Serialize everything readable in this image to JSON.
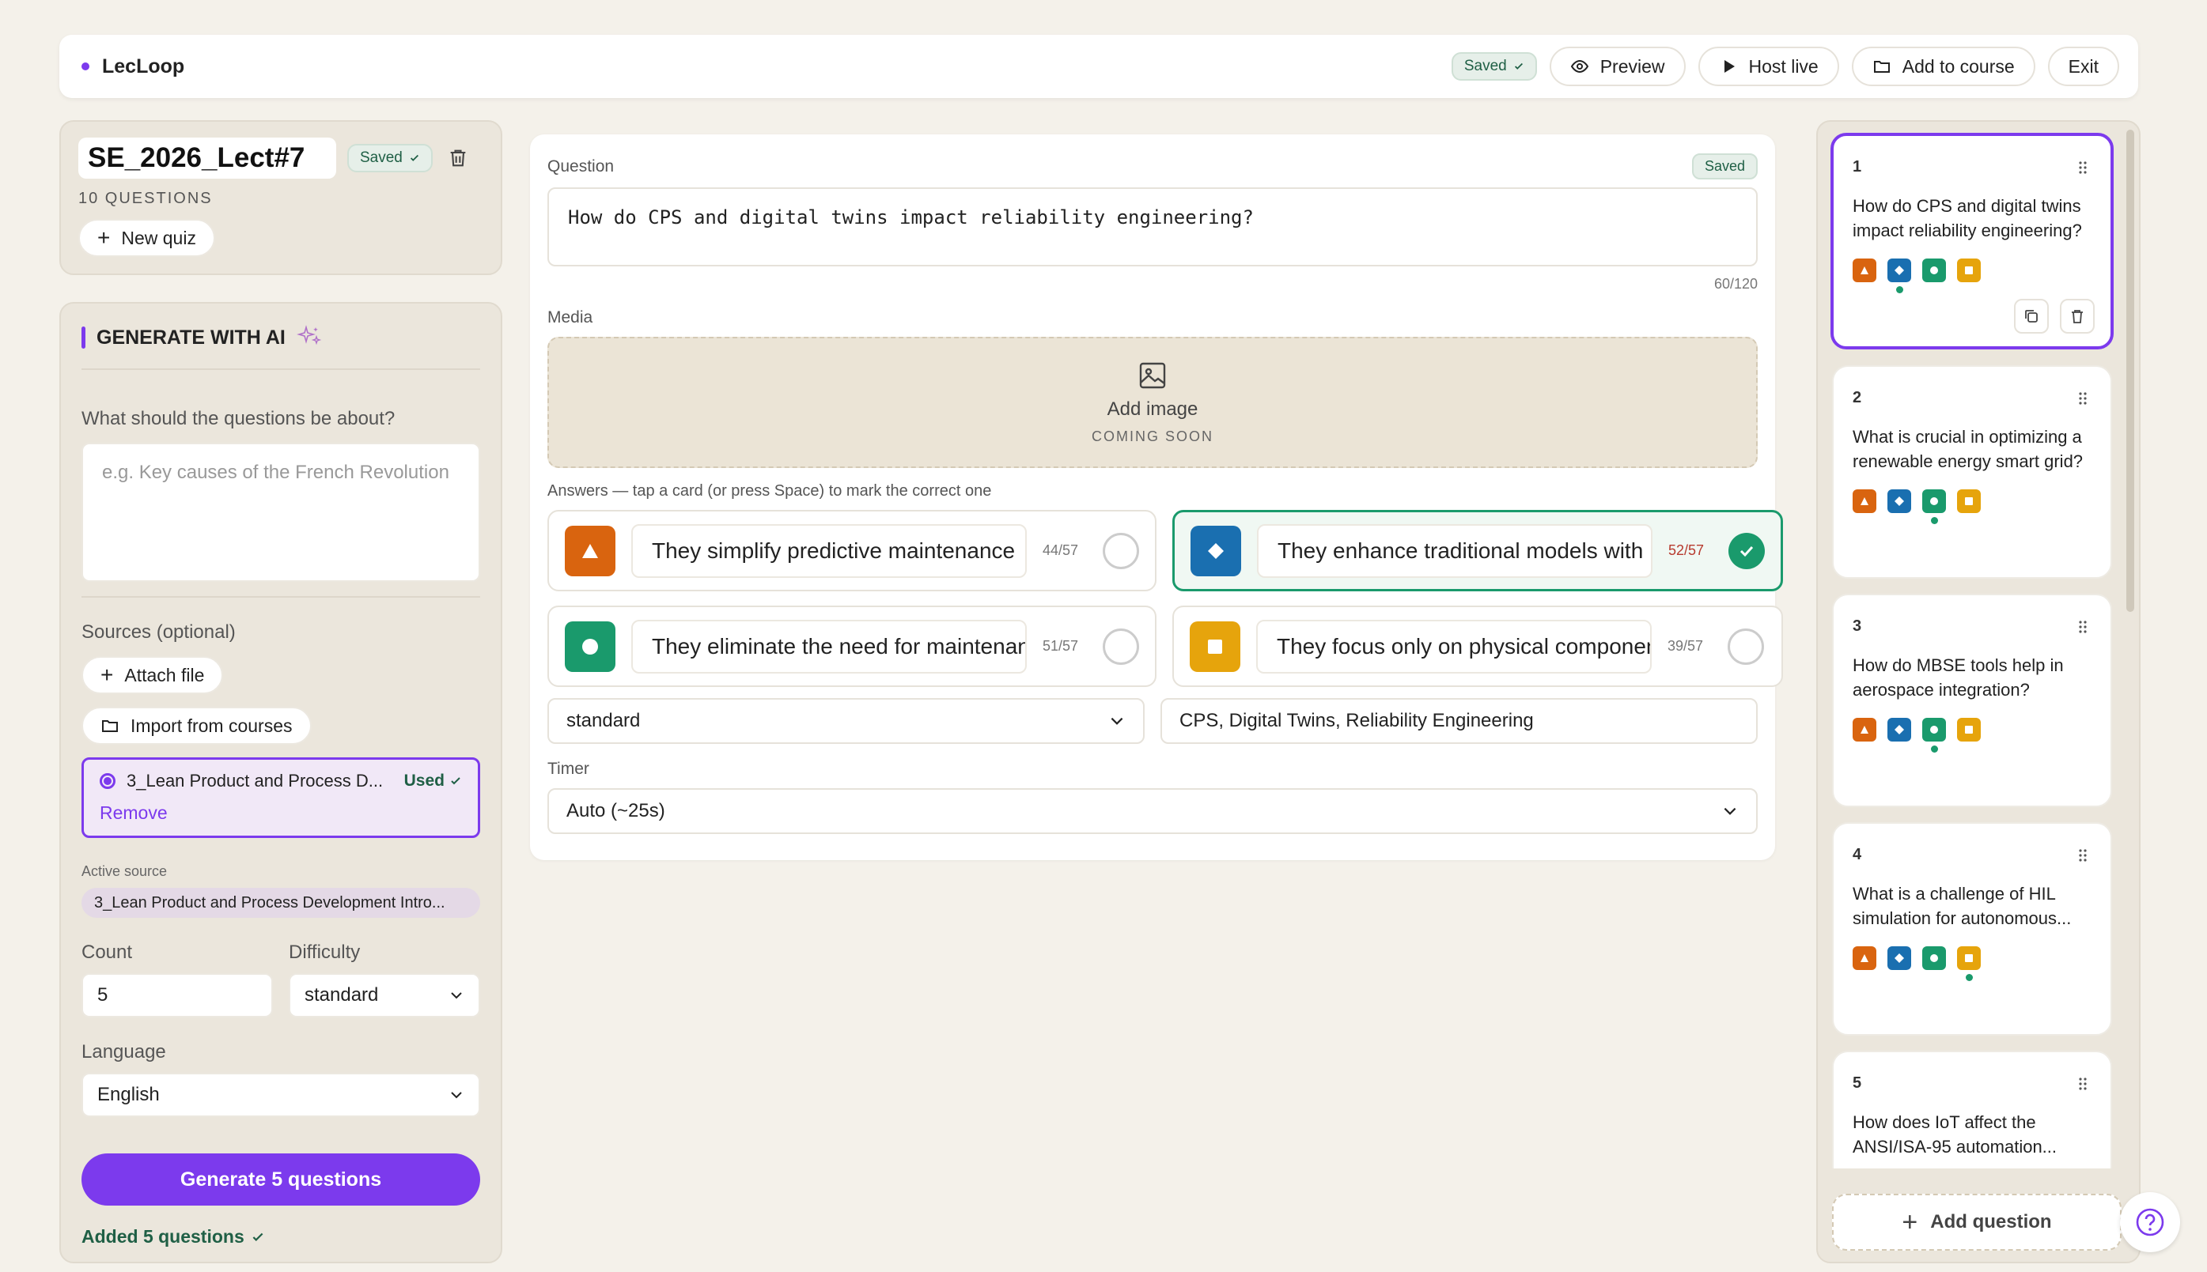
{
  "app": {
    "name": "LecLoop"
  },
  "colors": {
    "accent": "#7c3aed",
    "triangle": "#d9640f",
    "diamond": "#1a6fb0",
    "circle": "#1a9a6c",
    "square": "#e6a40c"
  },
  "topbar": {
    "saved": "Saved",
    "preview": "Preview",
    "host_live": "Host live",
    "add_to_course": "Add to course",
    "exit": "Exit"
  },
  "quiz": {
    "title": "SE_2026_Lect#7",
    "saved": "Saved",
    "count_label": "10 QUESTIONS",
    "new_quiz": "New quiz"
  },
  "ai": {
    "heading": "GENERATE WITH AI",
    "topic_label": "What should the questions be about?",
    "topic_placeholder": "e.g. Key causes of the French Revolution",
    "sources_label": "Sources (optional)",
    "attach_file": "Attach file",
    "import_courses": "Import from courses",
    "source_name": "3_Lean Product and Process D...",
    "source_used": "Used",
    "remove": "Remove",
    "active_source_label": "Active source",
    "active_source": "3_Lean Product and Process Development Intro...",
    "count_label": "Count",
    "count_value": "5",
    "difficulty_label": "Difficulty",
    "difficulty_value": "standard",
    "language_label": "Language",
    "language_value": "English",
    "generate_btn": "Generate 5 questions",
    "added_msg": "Added 5 questions"
  },
  "editor": {
    "question_label": "Question",
    "saved": "Saved",
    "question_text": "How do CPS and digital twins impact reliability engineering?",
    "char_count": "60/120",
    "media_label": "Media",
    "add_image": "Add image",
    "coming_soon": "COMING SOON",
    "answers_label": "Answers — tap a card (or press Space) to mark the correct one",
    "answers": [
      {
        "text": "They simplify predictive maintenance",
        "count": "44/57",
        "shape": "triangle",
        "correct": false
      },
      {
        "text": "They enhance traditional models with",
        "count": "52/57",
        "shape": "diamond",
        "correct": true
      },
      {
        "text": "They eliminate the need for maintenance",
        "count": "51/57",
        "shape": "circle",
        "correct": false
      },
      {
        "text": "They focus only on physical components",
        "count": "39/57",
        "shape": "square",
        "correct": false
      }
    ],
    "difficulty": "standard",
    "tags": "CPS, Digital Twins, Reliability Engineering",
    "timer_label": "Timer",
    "timer_value": "Auto (~25s)"
  },
  "questions": [
    {
      "num": "1",
      "text": "How do CPS and digital twins impact reliability engineering?",
      "correct": 1
    },
    {
      "num": "2",
      "text": "What is crucial in optimizing a renewable energy smart grid?",
      "correct": 2
    },
    {
      "num": "3",
      "text": "How do MBSE tools help in aerospace integration?",
      "correct": 2
    },
    {
      "num": "4",
      "text": "What is a challenge of HIL simulation for autonomous...",
      "correct": 3
    },
    {
      "num": "5",
      "text": "How does IoT affect the ANSI/ISA-95 automation...",
      "correct": 0
    }
  ],
  "add_question": "Add question"
}
